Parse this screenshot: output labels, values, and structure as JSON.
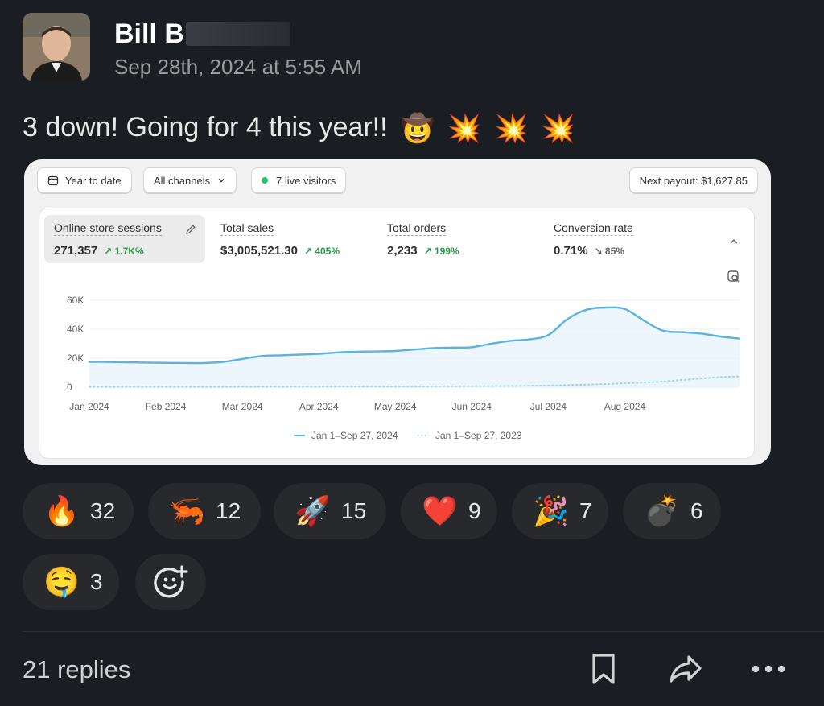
{
  "post": {
    "author": "Bill B",
    "timestamp": "Sep 28th, 2024 at 5:55 AM",
    "message": "3 down! Going for 4 this year!!",
    "message_emojis": [
      "🤠",
      "💥",
      "💥",
      "💥"
    ]
  },
  "dashboard": {
    "toolbar": {
      "date_range": "Year to date",
      "channels": "All channels",
      "live_visitors": "7 live visitors",
      "payout": "Next payout: $1,627.85"
    },
    "metrics": [
      {
        "label": "Online store sessions",
        "value": "271,357",
        "delta": "↗ 1.7K%",
        "direction": "up"
      },
      {
        "label": "Total sales",
        "value": "$3,005,521.30",
        "delta": "↗ 405%",
        "direction": "up"
      },
      {
        "label": "Total orders",
        "value": "2,233",
        "delta": "↗ 199%",
        "direction": "up"
      },
      {
        "label": "Conversion rate",
        "value": "0.71%",
        "delta": "↘ 85%",
        "direction": "down"
      }
    ]
  },
  "chart_data": {
    "type": "line",
    "title": "",
    "xlabel": "",
    "ylabel": "",
    "ylim": [
      0,
      60000
    ],
    "yticks": [
      0,
      20000,
      40000,
      60000
    ],
    "ytick_labels": [
      "0",
      "20K",
      "40K",
      "60K"
    ],
    "xtick_labels": [
      "Jan 2024",
      "Feb 2024",
      "Mar 2024",
      "Apr 2024",
      "May 2024",
      "Jun 2024",
      "Jul 2024",
      "Aug 2024"
    ],
    "x_months": [
      0,
      0.25,
      0.5,
      0.75,
      1,
      1.25,
      1.5,
      1.75,
      2,
      2.25,
      2.5,
      2.75,
      3,
      3.25,
      3.5,
      3.75,
      4,
      4.25,
      4.5,
      4.75,
      5,
      5.25,
      5.5,
      5.75,
      6,
      6.25,
      6.5,
      6.75,
      7,
      7.25,
      7.5,
      7.75,
      8,
      8.25,
      8.5
    ],
    "series": [
      {
        "name": "Jan 1–Sep 27, 2024",
        "color": "#5bb3e0",
        "style": "solid",
        "values": [
          17500,
          17400,
          17200,
          17000,
          16800,
          16700,
          16700,
          17500,
          19500,
          21500,
          22000,
          22500,
          23000,
          24000,
          24500,
          24700,
          25000,
          26000,
          27000,
          27300,
          27600,
          30000,
          32000,
          33000,
          36000,
          47000,
          53500,
          55000,
          54000,
          46000,
          39000,
          38000,
          37000,
          35000,
          33500
        ]
      },
      {
        "name": "Jan 1–Sep 27, 2023",
        "color": "#a5d3ef",
        "style": "dotted",
        "values": [
          200,
          200,
          200,
          200,
          200,
          200,
          200,
          200,
          300,
          300,
          300,
          300,
          300,
          400,
          400,
          400,
          500,
          500,
          600,
          600,
          700,
          800,
          900,
          1000,
          1200,
          1500,
          1800,
          2200,
          2700,
          3200,
          4000,
          5000,
          6000,
          7000,
          7500
        ]
      }
    ],
    "legend": "bottom-center",
    "grid": true
  },
  "reactions": [
    {
      "emoji": "🔥",
      "count": "32"
    },
    {
      "emoji": "🦐",
      "count": "12"
    },
    {
      "emoji": "🚀",
      "count": "15"
    },
    {
      "emoji": "❤️",
      "count": "9"
    },
    {
      "emoji": "🎉",
      "count": "7"
    },
    {
      "emoji": "💣",
      "count": "6"
    },
    {
      "emoji": "🤤",
      "count": "3"
    }
  ],
  "footer": {
    "replies": "21 replies"
  },
  "colors": {
    "background": "#1a1d21",
    "reaction_bg": "#27292d",
    "delta_up": "#2b9a4d"
  }
}
